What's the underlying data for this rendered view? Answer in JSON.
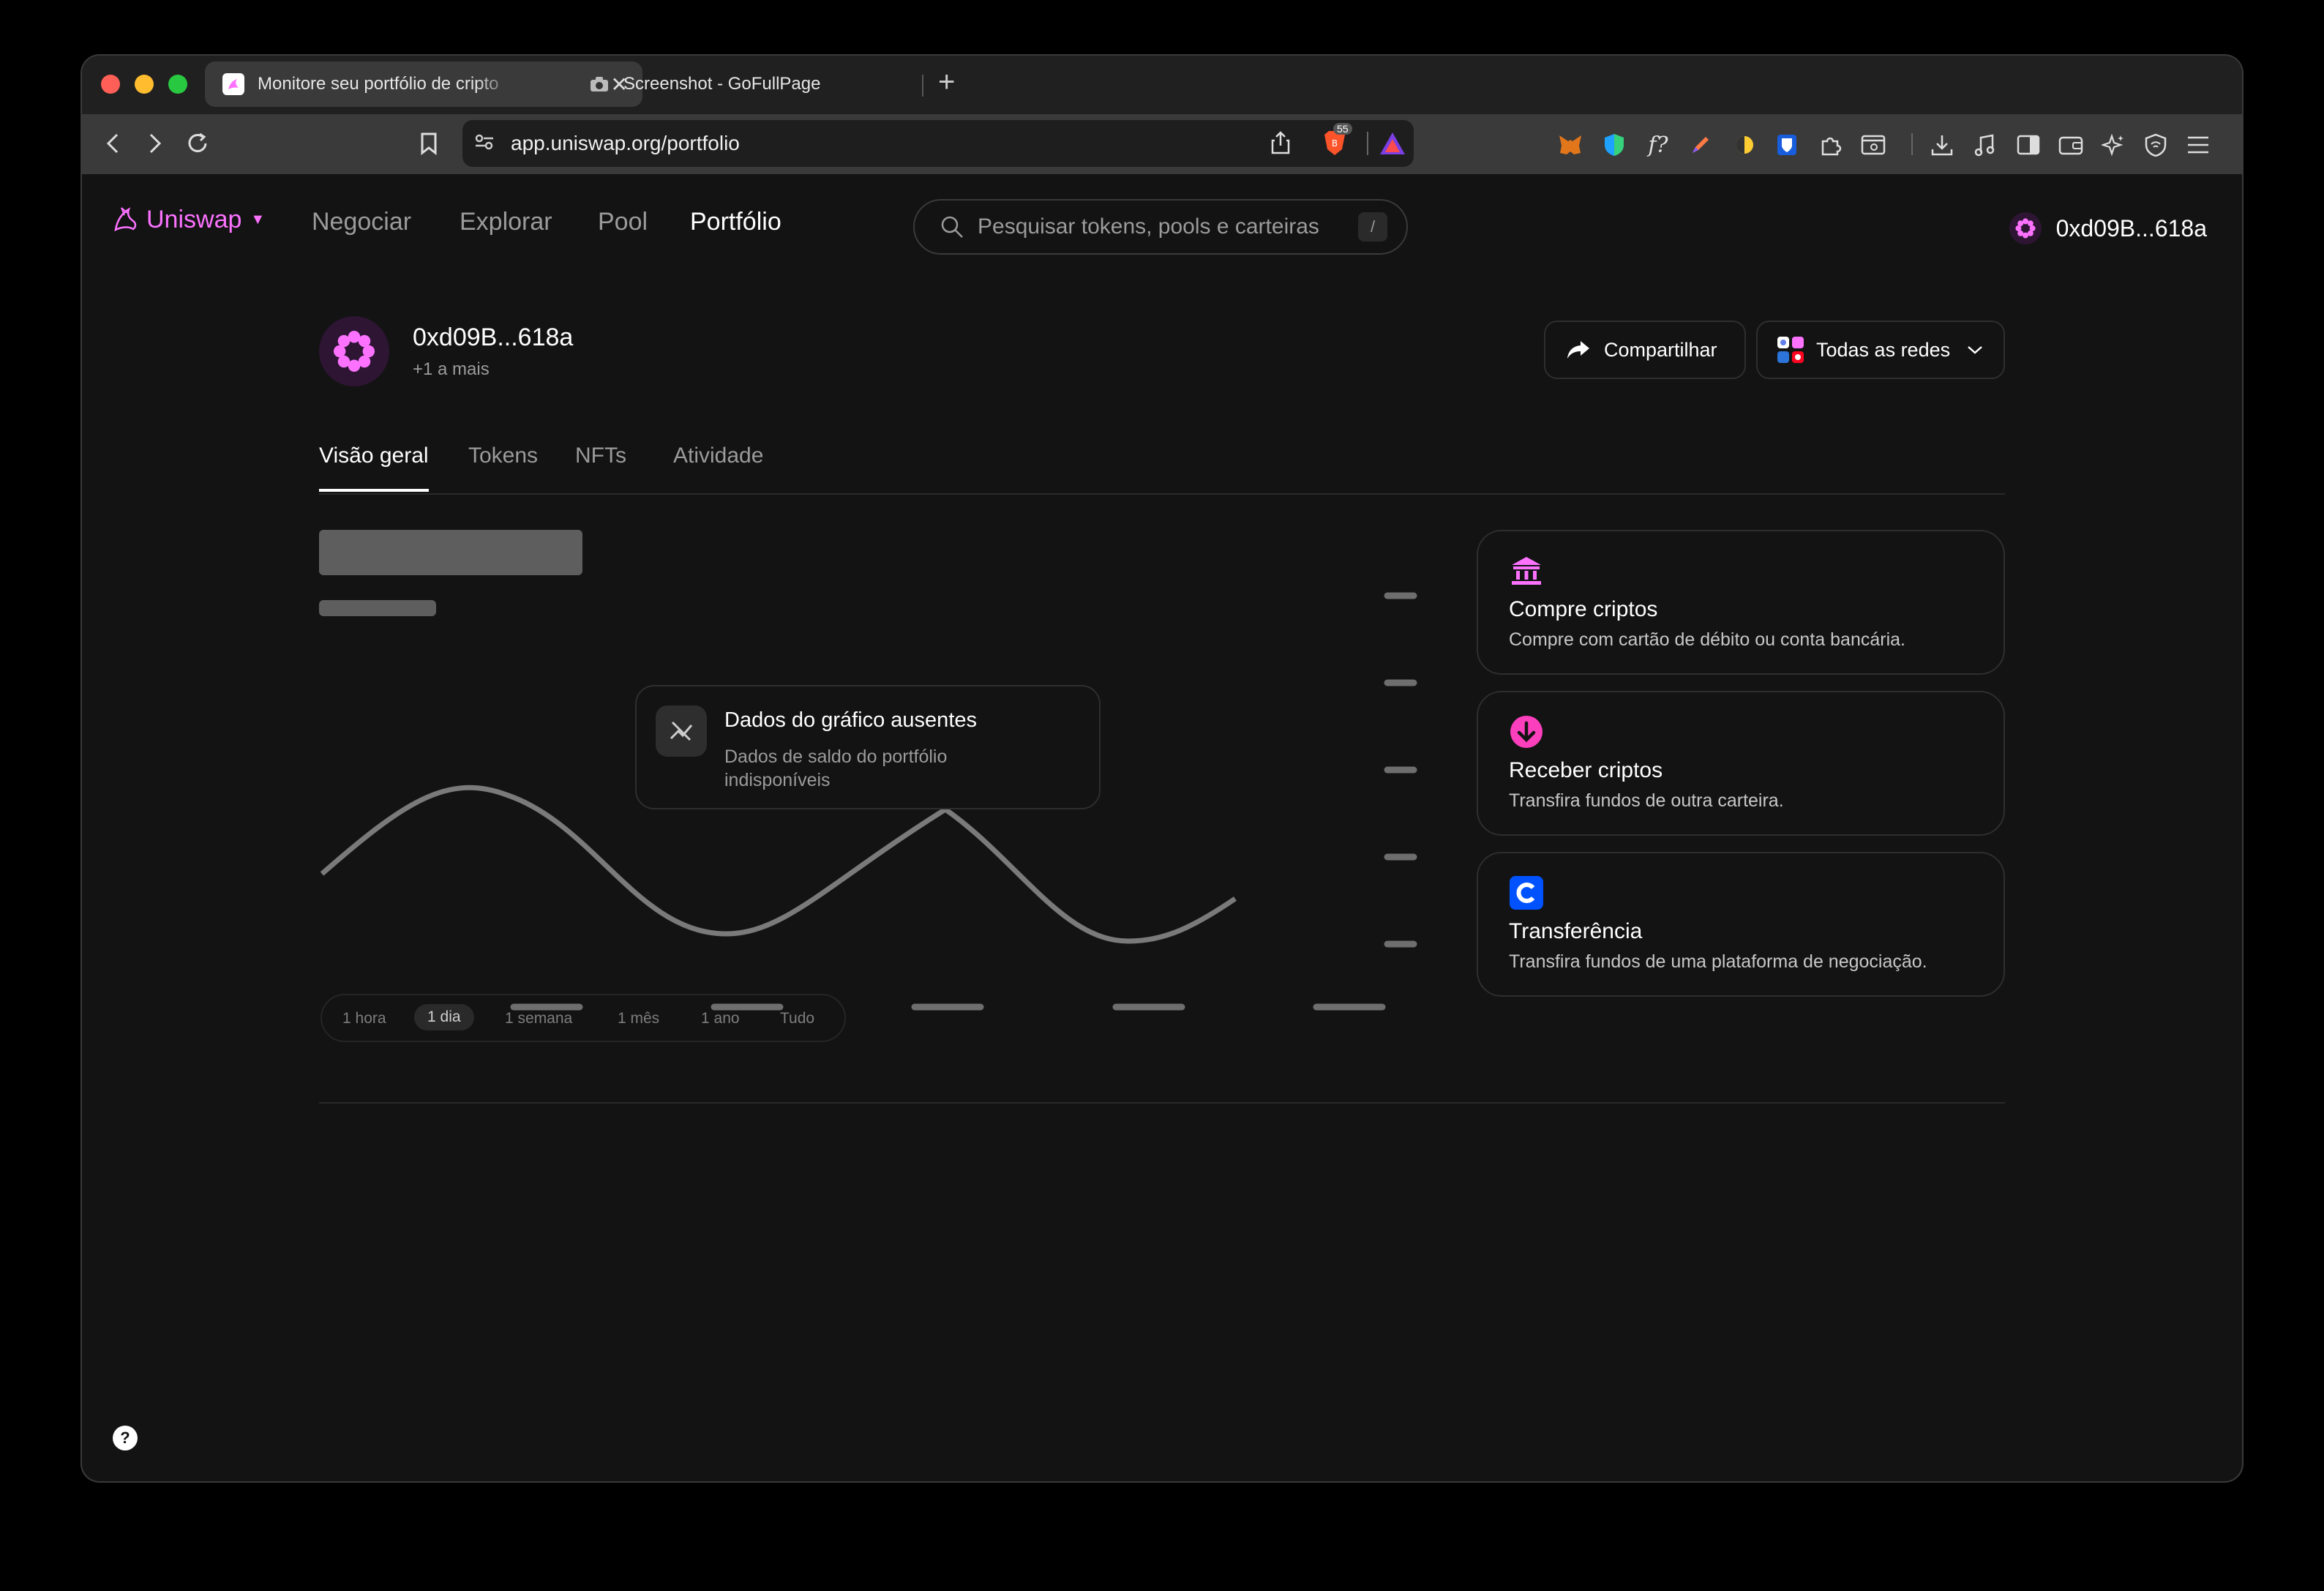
{
  "browser": {
    "tabs": [
      {
        "title": "Monitore seu portfólio de cripto",
        "active": true
      },
      {
        "title": "Screenshot - GoFullPage",
        "active": false
      }
    ],
    "url": "app.uniswap.org/portfolio",
    "badge_count": "55"
  },
  "header": {
    "logo_text": "Uniswap",
    "nav": [
      "Negociar",
      "Explorar",
      "Pool",
      "Portfólio"
    ],
    "search_placeholder": "Pesquisar tokens, pools e carteiras",
    "search_shortcut": "/",
    "account": "0xd09B...618a"
  },
  "profile": {
    "address": "0xd09B...618a",
    "more": "+1 a mais",
    "share_label": "Compartilhar",
    "networks_label": "Todas as redes"
  },
  "tabs": [
    "Visão geral",
    "Tokens",
    "NFTs",
    "Atividade"
  ],
  "chart_empty": {
    "title": "Dados do gráfico ausentes",
    "message": "Dados de saldo do portfólio indisponíveis"
  },
  "timeframes": [
    "1 hora",
    "1 dia",
    "1 semana",
    "1 mês",
    "1 ano",
    "Tudo"
  ],
  "timeframe_selected": "1 dia",
  "actions": [
    {
      "title": "Compre criptos",
      "desc": "Compre com cartão de débito ou conta bancária.",
      "icon": "bank-icon"
    },
    {
      "title": "Receber criptos",
      "desc": "Transfira fundos de outra carteira.",
      "icon": "receive-icon"
    },
    {
      "title": "Transferência",
      "desc": "Transfira fundos de uma plataforma de negociação.",
      "icon": "coinbase-icon"
    }
  ],
  "colors": {
    "accent": "#fc72ff",
    "background": "#131313"
  }
}
